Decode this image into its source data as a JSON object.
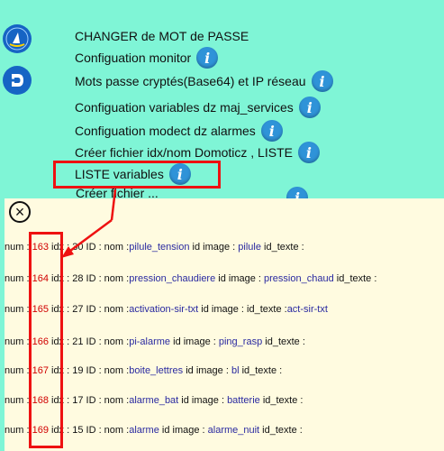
{
  "menu": {
    "items": [
      {
        "label": "CHANGER de MOT de PASSE",
        "info": false
      },
      {
        "label": "Configuation monitor",
        "info": true
      },
      {
        "label": "Mots passe cryptés(Base64) et IP réseau",
        "info": true
      },
      {
        "label": "Configuation variables dz maj_services",
        "info": true
      },
      {
        "label": "Configuation modect dz alarmes",
        "info": true
      },
      {
        "label": "Créer fichier idx/nom Domoticz , LISTE",
        "info": true
      },
      {
        "label": "LISTE variables",
        "info": true
      }
    ],
    "partial_label": "Créer fichier ..."
  },
  "icons": {
    "info": "i",
    "close": "×"
  },
  "popup": {
    "rows": [
      {
        "pre": "num : ",
        "num": "163",
        "mid": " idx : 30 ID :  nom :",
        "nom": "pilule_tension",
        "id_img": " id image : ",
        "img": "pilule",
        "id_tx": " id_texte :",
        "tx": ""
      },
      {
        "pre": "num : ",
        "num": "164",
        "mid": " idx : 28 ID :  nom :",
        "nom": "pression_chaudiere",
        "id_img": " id image : ",
        "img": "pression_chaud",
        "id_tx": " id_texte :",
        "tx": ""
      },
      {
        "pre": "num : ",
        "num": "165",
        "mid": " idx : 27 ID :  nom :",
        "nom": "activation-sir-txt",
        "id_img": " id image :   ",
        "img": "",
        "id_tx": "id_texte :",
        "tx": "act-sir-txt"
      },
      {
        "pre": "num : ",
        "num": "166",
        "mid": " idx : 21 ID :  nom :",
        "nom": "pi-alarme",
        "id_img": " id image : ",
        "img": "ping_rasp",
        "id_tx": " id_texte :",
        "tx": ""
      },
      {
        "pre": "num : ",
        "num": "167",
        "mid": " idx : 19 ID :  nom :",
        "nom": "boite_lettres",
        "id_img": " id image : ",
        "img": "bl",
        "id_tx": " id_texte :",
        "tx": ""
      },
      {
        "pre": "num : ",
        "num": "168",
        "mid": " idx : 17 ID :  nom :",
        "nom": "alarme_bat",
        "id_img": " id image : ",
        "img": "batterie",
        "id_tx": " id_texte :",
        "tx": ""
      },
      {
        "pre": "num : ",
        "num": "169",
        "mid": " idx : 15 ID :  nom :",
        "nom": "alarme",
        "id_img": " id image : ",
        "img": "alarme_nuit",
        "id_tx": " id_texte :",
        "tx": ""
      }
    ]
  },
  "colors": {
    "background": "#7ff5d6",
    "popup_bg": "#fffbe0",
    "annotation": "#e11111",
    "info_icon": "#2f93d8"
  }
}
